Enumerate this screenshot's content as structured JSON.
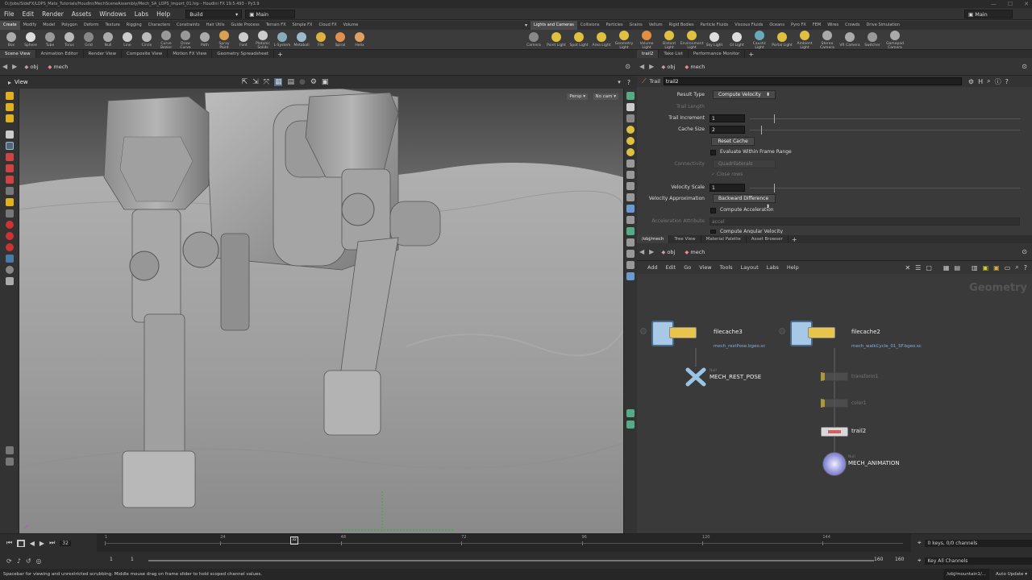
{
  "window": {
    "title": "D:/Jobs/SideFX/LOPS_Matx_Tutorials/Houdini/MechSceneAssembly/Mech_SA_LOPS_Import_01.hip - Houdini FX 19.5.493 - Py3.9"
  },
  "menubar": {
    "items": [
      "File",
      "Edit",
      "Render",
      "Assets",
      "Windows",
      "Labs",
      "Help"
    ],
    "build_label": "Build",
    "desktop_label": "Main",
    "right_desktop": "Main"
  },
  "shelf": {
    "left_tabs": [
      "Create",
      "Modify",
      "Model",
      "Polygon",
      "Deform",
      "Texture",
      "Rigging",
      "Characters",
      "Constraints",
      "Hair Utils",
      "Guide Process",
      "Terrain FX",
      "Simple FX",
      "Cloud FX",
      "Volume"
    ],
    "right_tabs": [
      "Lights and Cameras",
      "Collisions",
      "Particles",
      "Grains",
      "Vellum",
      "Rigid Bodies",
      "Particle Fluids",
      "Viscous Fluids",
      "Oceans",
      "Pyro FX",
      "FEM",
      "Wires",
      "Crowds",
      "Drive Simulation"
    ],
    "left_tools": [
      "Box",
      "Sphere",
      "Tube",
      "Torus",
      "Grid",
      "Null",
      "Line",
      "Circle",
      "Curve Bezier",
      "Draw Curve",
      "Path",
      "Spray Paint",
      "Font",
      "Platonic Solids",
      "L-System",
      "Metaball",
      "File",
      "Spiral",
      "Helix"
    ],
    "right_tools": [
      "Camera",
      "Point Light",
      "Spot Light",
      "Area Light",
      "Geometry Light",
      "Volume Light",
      "Distant Light",
      "Environment Light",
      "Sky Light",
      "GI Light",
      "Caustic Light",
      "Portal Light",
      "Ambient Light",
      "Stereo Camera",
      "VR Camera",
      "Switcher",
      "Gamepad Camera"
    ]
  },
  "left_pane": {
    "tabs": [
      "Scene View",
      "Animation Editor",
      "Render View",
      "Composite View",
      "Motion FX View",
      "Geometry Spreadsheet"
    ],
    "path": [
      "obj",
      "mech"
    ],
    "view_label": "View",
    "persp": "Persp",
    "cam": "No cam"
  },
  "right_pane": {
    "tabs": [
      "trail2",
      "Take List",
      "Performance Monitor"
    ],
    "path": [
      "obj",
      "mech"
    ],
    "node_type": "Trail",
    "node_name": "trail2",
    "params": {
      "result_type_label": "Result Type",
      "result_type": "Compute Velocity",
      "trail_length_label": "Trail Length",
      "trail_increment_label": "Trail Increment",
      "trail_increment": "1",
      "cache_size_label": "Cache Size",
      "cache_size": "2",
      "reset_cache": "Reset Cache",
      "eval_range": "Evaluate Within Frame Range",
      "connectivity_label": "Connectivity",
      "connectivity": "Quadrilaterals",
      "close_rows": "Close rows",
      "velocity_scale_label": "Velocity Scale",
      "velocity_scale": "1",
      "velocity_approx_label": "Velocity Approximation",
      "velocity_approx": "Backward Difference",
      "compute_accel": "Compute Acceleration",
      "accel_attr_label": "Acceleration Attribute",
      "accel_attr": "accel",
      "compute_ang_vel": "Compute Angular Velocity"
    }
  },
  "network": {
    "tabs": [
      "/obj/mech",
      "Tree View",
      "Material Palette",
      "Asset Browser"
    ],
    "path": [
      "obj",
      "mech"
    ],
    "menu": [
      "Add",
      "Edit",
      "Go",
      "View",
      "Tools",
      "Layout",
      "Labs",
      "Help"
    ],
    "context_label": "Geometry",
    "nodes": {
      "filecache3": "filecache3",
      "filecache3_file": "mech_restPose.bgeo.sc",
      "rest_pose_type": "Null",
      "rest_pose": "MECH_REST_POSE",
      "filecache2": "filecache2",
      "filecache2_file": "mech_walkCycle_01_SF.bgeo.sc",
      "transform1": "transform1",
      "color1": "color1",
      "trail2": "trail2",
      "anim_type": "Null",
      "anim": "MECH_ANIMATION"
    }
  },
  "timeline": {
    "current_frame": "32",
    "frame_marker": "32",
    "ticks": [
      "1",
      "24",
      "48",
      "72",
      "96",
      "120",
      "144"
    ],
    "start": "1",
    "start2": "1",
    "end": "160",
    "end2": "160",
    "keys": "0 keys, 0/0 channels",
    "key_all": "Key All Channels"
  },
  "status": {
    "message": "Spacebar for viewing and unrestricted scrubbing. Middle mouse drag on frame slider to hold scoped channel values.",
    "path": "/obj/mountain1/...",
    "auto_update": "Auto Update"
  }
}
